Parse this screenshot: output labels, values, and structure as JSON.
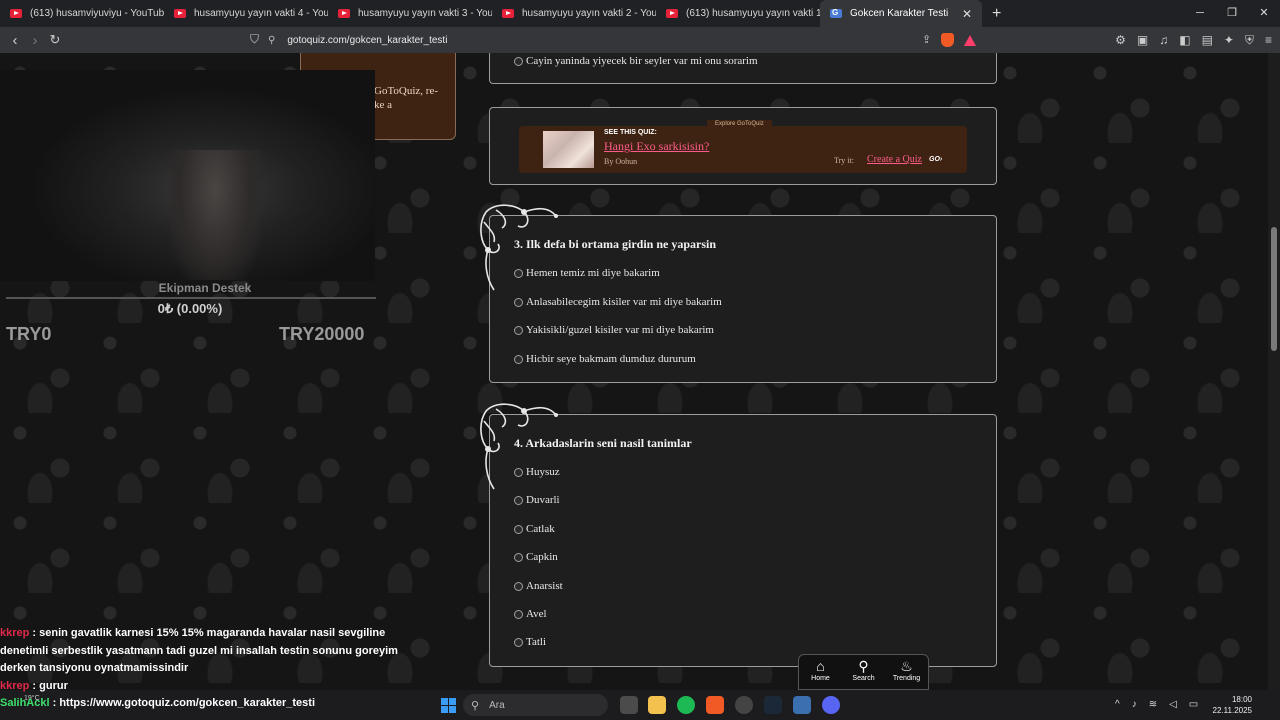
{
  "browser": {
    "tabs": [
      {
        "title": "(613) husamviyuviyu - YouTube"
      },
      {
        "title": "husamyuyu yayın vakti 4 - YouTube"
      },
      {
        "title": "husamyuyu yayın vakti 3 - YouTube"
      },
      {
        "title": "husamyuyu yayın vakti 2 - YouTube"
      },
      {
        "title": "(613) husamyuyu yayın vakti 1 - YouTube"
      },
      {
        "title": "Gokcen Karakter Testi"
      }
    ],
    "url": "gotoquiz.com/gokcen_karakter_testi"
  },
  "quiz": {
    "prev_option": "Cayin yaninda yiyecek bir seyler var mi onu sorarim",
    "ad": {
      "explore": "Explore GoToQuiz",
      "see": "SEE THIS QUIZ:",
      "quiz_title": "Hangi Exo sarkisisin?",
      "by": "By Oohun",
      "try_it": "Try it:",
      "create": "Create a Quiz",
      "go": "GO›"
    },
    "q3": {
      "title": "3. Ilk defa bi ortama girdin ne yaparsin",
      "options": [
        "Hemen temiz mi diye bakarim",
        "Anlasabilecegim kisiler var mi diye bakarim",
        "Yakisikli/guzel kisiler var mi diye bakarim",
        "Hicbir seye bakmam dumduz dururum"
      ]
    },
    "q4": {
      "title": "4. Arkadaslarin seni nasil tanimlar",
      "options": [
        "Huysuz",
        "Duvarli",
        "Catlak",
        "Capkin",
        "Anarsist",
        "Avel",
        "Tatli"
      ]
    },
    "left_panel_text": [
      "GoToQuiz, re-",
      "ke a"
    ]
  },
  "site_nav": [
    {
      "label": "Home",
      "icon": "home-icon"
    },
    {
      "label": "Search",
      "icon": "search-icon"
    },
    {
      "label": "Trending",
      "icon": "fire-icon"
    }
  ],
  "overlay": {
    "donation_name": "Ekipman Destek",
    "donation_progress": "0₺ (0.00%)",
    "donation_min": "TRY0",
    "donation_max": "TRY20000",
    "chat": [
      {
        "user": "kkrep",
        "text": "senin gavatlik karnesi 15% 15% magaranda havalar nasil sevgiline denetimli serbestlik yasatmann tadi guzel mi insallah testin sonunu goreyim derken tansiyonu oynatmamissindir"
      },
      {
        "user": "kkrep",
        "text": "gurur"
      },
      {
        "user": "SalihAckl",
        "text": "https://www.gotoquiz.com/gokcen_karakter_testi"
      }
    ]
  },
  "taskbar": {
    "search_placeholder": "Ara",
    "time": "18:00",
    "date": "22.11.2025",
    "weather": "19°C"
  }
}
